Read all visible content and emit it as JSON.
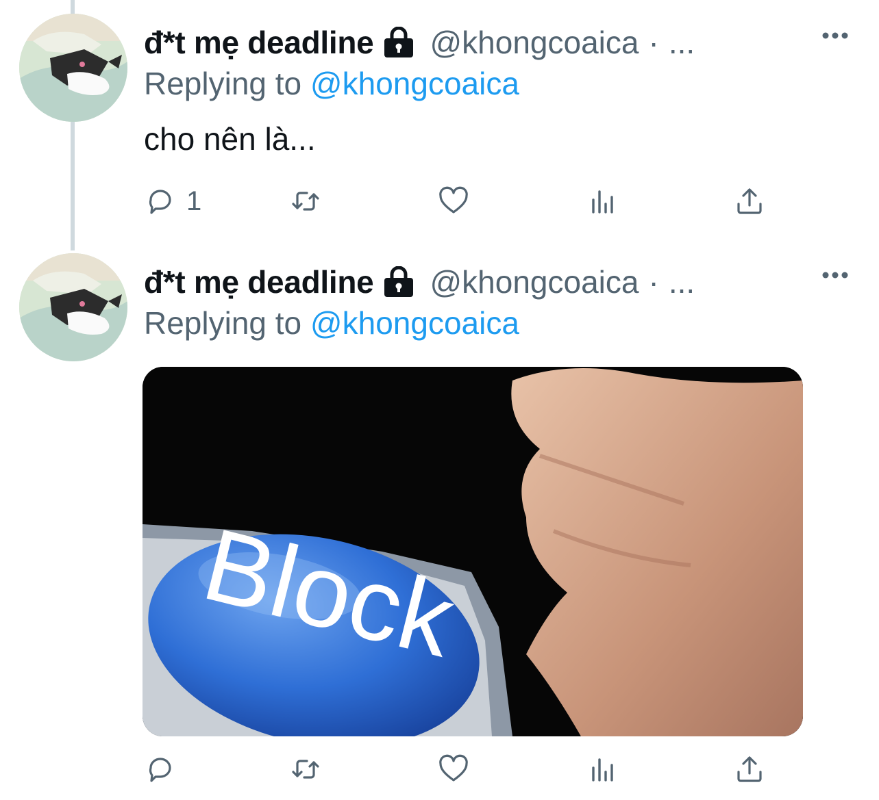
{
  "tweets": [
    {
      "display_name": "đ*t mẹ deadline",
      "handle": "@khongcoaica",
      "separator": "·",
      "truncation": "...",
      "replying_prefix": "Replying to",
      "replying_to": "@khongcoaica",
      "text": "cho nên là...",
      "reply_count": "1",
      "icons": [
        "lock-icon",
        "more-icon",
        "reply-icon",
        "retweet-icon",
        "like-icon",
        "views-icon",
        "share-icon"
      ]
    },
    {
      "display_name": "đ*t mẹ deadline",
      "handle": "@khongcoaica",
      "separator": "·",
      "truncation": "...",
      "replying_prefix": "Replying to",
      "replying_to": "@khongcoaica",
      "media_text": "Block",
      "icons": [
        "lock-icon",
        "more-icon",
        "reply-icon",
        "retweet-icon",
        "like-icon",
        "views-icon",
        "share-icon"
      ]
    }
  ],
  "colors": {
    "text_primary": "#0f1419",
    "text_secondary": "#536471",
    "link": "#1d9bf0",
    "thread_line": "#cfd9de",
    "block_button": "#2f6fd6"
  }
}
